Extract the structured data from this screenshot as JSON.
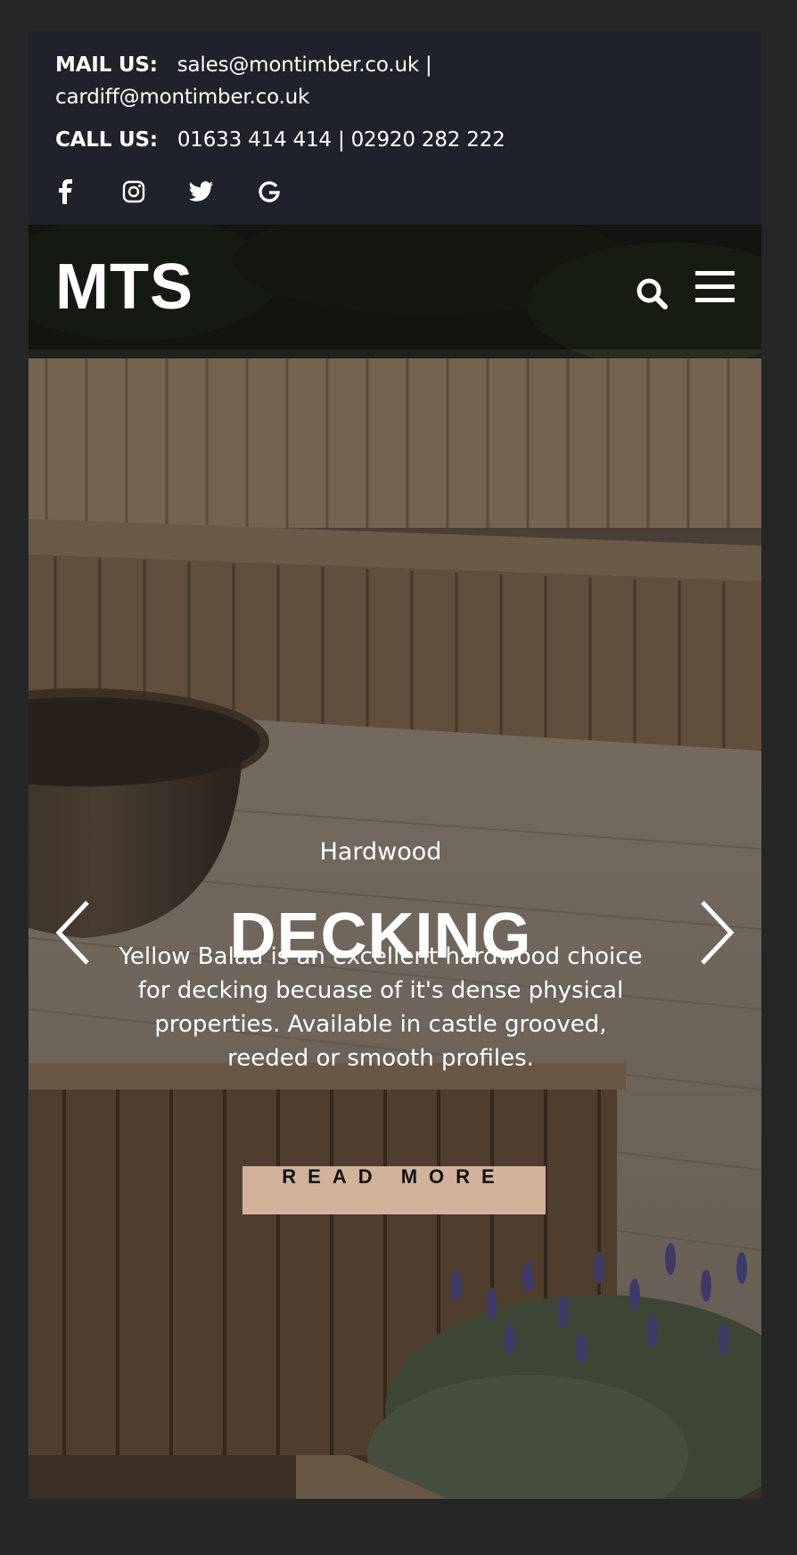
{
  "topbar": {
    "mail_label": "MAIL US:",
    "mail_value": "sales@montimber.co.uk | cardiff@montimber.co.uk",
    "call_label": "CALL US:",
    "call_value": "01633 414 414 | 02920 282 222",
    "socials": [
      "facebook-icon",
      "instagram-icon",
      "twitter-icon",
      "google-icon"
    ]
  },
  "header": {
    "logo": "MTS",
    "icons": [
      "search-icon",
      "hamburger-menu-icon"
    ]
  },
  "slide": {
    "subtitle": "Hardwood",
    "title": "DECKING",
    "description": "Yellow Balau is an excellent hardwood choice for decking becuase of it's dense physical properties. Available in castle grooved, reeded or smooth profiles.",
    "button_label": "READ MORE",
    "prev_icon": "chevron-left-icon",
    "next_icon": "chevron-right-icon"
  },
  "colors": {
    "page_bg": "#252628",
    "topbar_bg": "#1f222a",
    "button_bg": "#d2b29a",
    "text": "#ffffff"
  }
}
